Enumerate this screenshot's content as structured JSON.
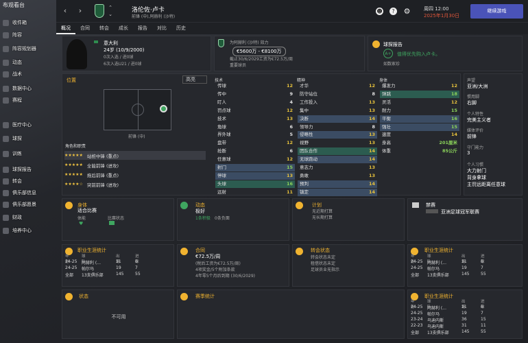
{
  "colors": {
    "accent": "#4a53b8",
    "yellow": "#f0b330",
    "green": "#2f8c4f",
    "red": "#e0563a"
  },
  "sidebar": {
    "logo_text": "布观看台",
    "items": [
      {
        "label": "收件箱",
        "icon": "inbox-icon"
      },
      {
        "label": "阵容",
        "icon": "squad-icon"
      },
      {
        "label": "阵容规划器",
        "icon": "planner-icon"
      },
      {
        "label": "动态",
        "icon": "dynamics-icon"
      },
      {
        "label": "战术",
        "icon": "tactics-icon"
      },
      {
        "label": "数据中心",
        "icon": "data-icon"
      },
      {
        "label": "赛程",
        "icon": "calendar-icon"
      },
      {
        "label": "医疗中心",
        "icon": "medical-icon"
      },
      {
        "label": "球探",
        "icon": "scout-icon"
      },
      {
        "label": "训练",
        "icon": "training-icon"
      },
      {
        "label": "球探报告",
        "icon": "report-icon"
      },
      {
        "label": "转会",
        "icon": "transfer-icon"
      },
      {
        "label": "俱乐部信息",
        "icon": "club-icon"
      },
      {
        "label": "俱乐部愿景",
        "icon": "vision-icon"
      },
      {
        "label": "财政",
        "icon": "finance-icon"
      },
      {
        "label": "培养中心",
        "icon": "dev-icon"
      }
    ]
  },
  "topbar": {
    "player_name": "洛伦佐·卢卡",
    "subtitle": "前锋 (中),阿赫利 (沙特)",
    "time": "周四 12:00",
    "date": "2025年1月30日",
    "continue": "继续游戏",
    "help": "?"
  },
  "tabs": [
    "概况",
    "合同",
    "转会",
    "成长",
    "报告",
    "对比",
    "历史"
  ],
  "profile": {
    "nation": "意大利",
    "age": "24岁 (10/9/2000)",
    "caps": "0次入选 / 进0球",
    "u21": "6次入选U21 / 进0球"
  },
  "club_info": {
    "label": "为阿赫利 (沙特) 效力",
    "value": "€5600万 - €8100万",
    "contract": "截止30/6/2029工资为€72.5万/周",
    "role": "重要球员"
  },
  "scout": {
    "title": "球探报告",
    "grade": "A+",
    "recommend": "值得优先购入卢卡。",
    "sub": "如数家珍"
  },
  "position": {
    "title": "位置",
    "mode": "高亮",
    "role_name": "前锋 (中)"
  },
  "roles": {
    "title": "角色和职责",
    "items": [
      {
        "stars": "★★★★★",
        "name": "站桩中锋 (重点)"
      },
      {
        "stars": "★★★★★",
        "name": "全能前锋 (进攻)"
      },
      {
        "stars": "★★★★★",
        "name": "拖后前锋 (重点)"
      },
      {
        "stars": "★★★★☆",
        "name": "突前前锋 (进攻)"
      }
    ]
  },
  "technical": {
    "title": "技术",
    "attrs": [
      [
        "传球",
        "12"
      ],
      [
        "传中",
        "9"
      ],
      [
        "盯人",
        "4"
      ],
      [
        "罚点球",
        "12"
      ],
      [
        "技术",
        "13"
      ],
      [
        "角球",
        "6"
      ],
      [
        "界外球",
        "5"
      ],
      [
        "盘带",
        "12"
      ],
      [
        "抢断",
        "6"
      ],
      [
        "任意球",
        "12"
      ],
      [
        "射门",
        "15"
      ],
      [
        "停球",
        "13"
      ],
      [
        "头球",
        "16"
      ],
      [
        "远射",
        "11"
      ]
    ]
  },
  "mental": {
    "title": "精神",
    "attrs": [
      [
        "才华",
        "12"
      ],
      [
        "防守站位",
        "8"
      ],
      [
        "工作投入",
        "13"
      ],
      [
        "集中",
        "13"
      ],
      [
        "决断",
        "14"
      ],
      [
        "领导力",
        "8"
      ],
      [
        "侵略性",
        "13"
      ],
      [
        "视野",
        "13"
      ],
      [
        "团队合作",
        "14"
      ],
      [
        "无球跑动",
        "14"
      ],
      [
        "意志力",
        "13"
      ],
      [
        "勇敢",
        "13"
      ],
      [
        "预判",
        "14"
      ],
      [
        "镇定",
        "14"
      ]
    ]
  },
  "physical": {
    "title": "身体",
    "attrs": [
      [
        "爆发力",
        "12"
      ],
      [
        "弹跳",
        "18"
      ],
      [
        "灵活",
        "12"
      ],
      [
        "耐力",
        "15"
      ],
      [
        "平衡",
        "16"
      ],
      [
        "强壮",
        "15"
      ],
      [
        "速度",
        "14"
      ],
      [
        "身高",
        "201厘米"
      ],
      [
        "体重",
        "85公斤"
      ]
    ]
  },
  "right": {
    "rep_label": "声望",
    "rep_val": "亚洲/大洲",
    "foot_label": "惯用脚",
    "foot_val": "右脚",
    "personality_label": "个人特性",
    "personality_val": "完美主义者",
    "media_label": "媒体评价",
    "media_val": "前锋",
    "gk_label": "守门能力",
    "gk_val": "3",
    "traits_label": "个人习惯",
    "traits": [
      "大力射门",
      "背身拿球",
      "主罚远距离任意球"
    ]
  },
  "cards": {
    "condition": {
      "title": "身体",
      "val": "适合比赛",
      "c1": "体能",
      "c2": "比赛状态"
    },
    "morale": {
      "title": "动态",
      "val": "极好",
      "sub1": "1条积极",
      "sub2": "0条负面"
    },
    "plan": {
      "title": "计划",
      "l1": "无近期打算",
      "l2": "无长期打算"
    },
    "ban": {
      "title": "禁赛",
      "val": "亚洲足球冠军联赛"
    },
    "career": {
      "title": "职业生涯统计",
      "h": [
        "年份",
        "球队",
        "出场",
        "进球"
      ],
      "rows": [
        [
          "24-25",
          "阿赫利 (...",
          "11",
          "6"
        ],
        [
          "24-25",
          "帕尔马",
          "19",
          "7"
        ],
        [
          "全部",
          "13支俱乐部",
          "145",
          "55"
        ]
      ]
    },
    "contract": {
      "title": "合同",
      "wage": "€72.5万/周",
      "l1": "(税后工资为€72.5万/周)",
      "l2": "4项奖金/5个附加条款",
      "l3": "4年零5个月后到期 (30/6/2029)"
    },
    "transfer": {
      "title": "转会状态",
      "l1": "转会状态未定",
      "l2": "租借状态未定",
      "l3": "足球员业无指示"
    },
    "career2": {
      "title": "职业生涯统计",
      "h": [
        "年份",
        "球队",
        "出场",
        "进球"
      ],
      "rows": [
        [
          "24-25",
          "阿赫利 (...",
          "11",
          "6"
        ],
        [
          "24-25",
          "帕尔马",
          "19",
          "7"
        ],
        [
          "全部",
          "13支俱乐部",
          "145",
          "55"
        ]
      ]
    },
    "status": {
      "title": "状态",
      "val": "不可用"
    },
    "season": {
      "title": "赛季统计"
    },
    "career3": {
      "title": "职业生涯统计",
      "h": [
        "年份",
        "球队",
        "出场",
        "进球"
      ],
      "rows": [
        [
          "24-25",
          "阿赫利 (...",
          "11",
          "6"
        ],
        [
          "24-25",
          "帕尔马",
          "19",
          "7"
        ],
        [
          "23-24",
          "乌迪内斯",
          "36",
          "15"
        ],
        [
          "22-23",
          "乌迪内斯",
          "31",
          "11"
        ],
        [
          "全部",
          "13支俱乐部",
          "145",
          "55"
        ]
      ]
    }
  }
}
